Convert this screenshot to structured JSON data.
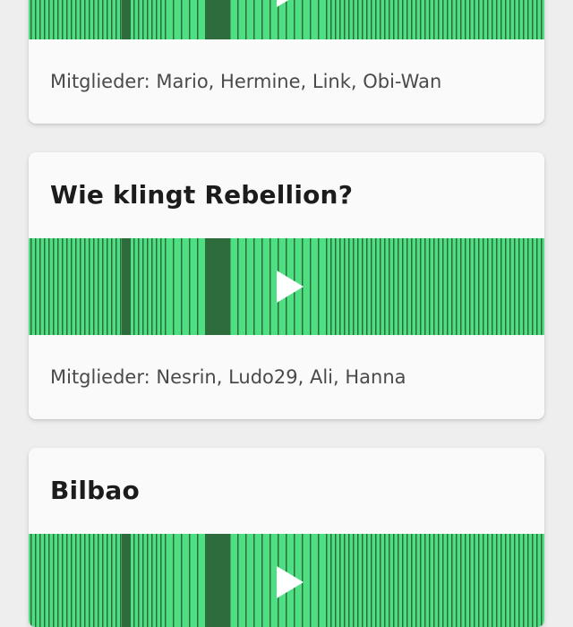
{
  "playlists": [
    {
      "title": "",
      "members_text": "Mitglieder: Mario, Hermine, Link, Obi-Wan"
    },
    {
      "title": "Wie klingt Rebellion?",
      "members_text": "Mitglieder: Nesrin, Ludo29, Ali, Hanna"
    },
    {
      "title": "Bilbao",
      "members_text": ""
    }
  ],
  "icons": {
    "play": "play-icon"
  },
  "colors": {
    "page_background": "#eeeeee",
    "card_background": "#fafafa",
    "waveform_light": "#4ddf82",
    "waveform_dark": "#2e6b3d",
    "play_icon": "#ffffff"
  }
}
